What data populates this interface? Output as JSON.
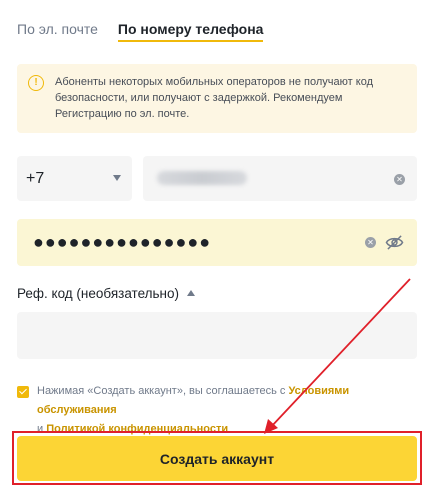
{
  "tabs": {
    "email": "По эл. почте",
    "phone": "По номеру телефона"
  },
  "notice": {
    "icon": "warning-circle-icon",
    "text": "Абоненты некоторых мобильных операторов не получают код безопасности, или получают с задержкой. Рекомендуем Регистрацию по эл. почте."
  },
  "phone": {
    "country_code": "+7",
    "value_obscured": true
  },
  "password": {
    "value": "●●●●●●●●●●●●●●●"
  },
  "referral": {
    "label": "Реф. код (необязательно)",
    "value": ""
  },
  "agreement": {
    "checked": true,
    "prefix": "Нажимая «Создать аккаунт», вы соглашаетесь с",
    "terms_link": "Условиями обслуживания",
    "conjunction": "и",
    "privacy_link": "Политикой конфиденциальности"
  },
  "submit_label": "Создать аккаунт",
  "colors": {
    "accent": "#fcd535",
    "link": "#c99400",
    "annotation": "#e0202a"
  }
}
